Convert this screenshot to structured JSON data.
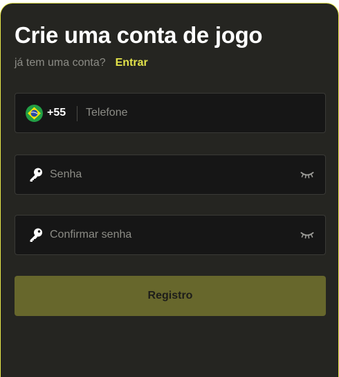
{
  "header": {
    "title": "Crie uma conta de jogo",
    "question": "já tem uma conta?",
    "login_link": "Entrar"
  },
  "phone_field": {
    "country_code": "+55",
    "flag": "brazil-flag-icon",
    "placeholder": "Telefone"
  },
  "password_field": {
    "placeholder": "Senha",
    "left_icon": "key-icon",
    "right_icon": "eye-closed-icon"
  },
  "confirm_field": {
    "placeholder": "Confirmar senha",
    "left_icon": "key-icon",
    "right_icon": "eye-closed-icon"
  },
  "submit": {
    "label": "Registro"
  },
  "colors": {
    "panel_bg": "#252521",
    "accent": "#e3e34a",
    "field_bg": "#161616",
    "button_bg": "#67672c"
  }
}
